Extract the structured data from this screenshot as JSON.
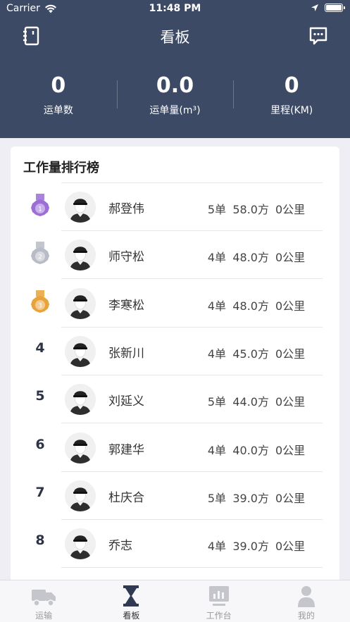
{
  "status_bar": {
    "carrier": "Carrier",
    "time": "11:48 PM"
  },
  "nav": {
    "title": "看板",
    "left_icon": "notebook-icon",
    "right_icon": "message-icon"
  },
  "stats": [
    {
      "value": "0",
      "label": "运单数"
    },
    {
      "value": "0.0",
      "label": "运单量(m³)"
    },
    {
      "value": "0",
      "label": "里程(KM)"
    }
  ],
  "ranking": {
    "title": "工作量排行榜",
    "rows": [
      {
        "rank": "1",
        "medal": "purple",
        "name": "郝登伟",
        "orders": "5单",
        "volume": "58.0方",
        "distance": "0公里"
      },
      {
        "rank": "2",
        "medal": "silver",
        "name": "师守松",
        "orders": "4单",
        "volume": "48.0方",
        "distance": "0公里"
      },
      {
        "rank": "3",
        "medal": "gold",
        "name": "李寒松",
        "orders": "4单",
        "volume": "48.0方",
        "distance": "0公里"
      },
      {
        "rank": "4",
        "name": "张新川",
        "orders": "4单",
        "volume": "45.0方",
        "distance": "0公里"
      },
      {
        "rank": "5",
        "name": "刘延义",
        "orders": "5单",
        "volume": "44.0方",
        "distance": "0公里"
      },
      {
        "rank": "6",
        "name": "郭建华",
        "orders": "4单",
        "volume": "40.0方",
        "distance": "0公里"
      },
      {
        "rank": "7",
        "name": "杜庆合",
        "orders": "5单",
        "volume": "39.0方",
        "distance": "0公里"
      },
      {
        "rank": "8",
        "name": "乔志",
        "orders": "4单",
        "volume": "39.0方",
        "distance": "0公里"
      }
    ]
  },
  "tabs": [
    {
      "label": "运输",
      "icon": "truck-icon",
      "active": false
    },
    {
      "label": "看板",
      "icon": "hourglass-icon",
      "active": true
    },
    {
      "label": "工作台",
      "icon": "dashboard-icon",
      "active": false
    },
    {
      "label": "我的",
      "icon": "user-icon",
      "active": false
    }
  ],
  "colors": {
    "header": "#3d4a66",
    "medal_purple": "#9b6fd6",
    "medal_silver": "#b8bcc6",
    "medal_gold": "#e8a33a"
  }
}
